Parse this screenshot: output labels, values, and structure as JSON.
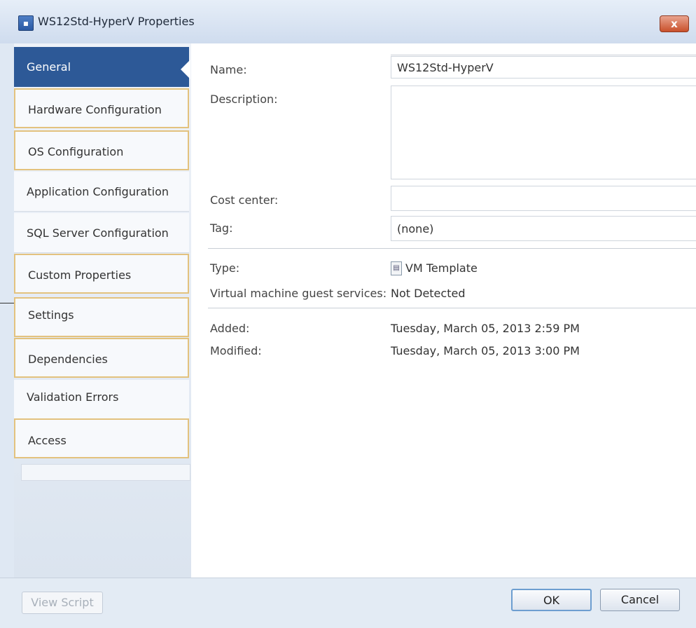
{
  "window": {
    "title": "WS12Std-HyperV Properties",
    "close_label": "x"
  },
  "sidebar": {
    "items": [
      {
        "label": "General"
      },
      {
        "label": "Hardware Configuration"
      },
      {
        "label": "OS Configuration"
      },
      {
        "label": "Application Configuration"
      },
      {
        "label": "SQL Server Configuration"
      },
      {
        "label": "Custom Properties"
      },
      {
        "label": "Settings"
      },
      {
        "label": "Dependencies"
      },
      {
        "label": "Validation Errors"
      },
      {
        "label": "Access"
      }
    ],
    "active_index": 0
  },
  "general": {
    "name_label": "Name:",
    "name_value": "WS12Std-HyperV",
    "description_label": "Description:",
    "description_value": "",
    "cost_center_label": "Cost center:",
    "cost_center_value": "",
    "tag_label": "Tag:",
    "tag_value": "(none)",
    "type_label": "Type:",
    "type_value": "VM Template",
    "guest_services_label": "Virtual machine guest services:",
    "guest_services_value": "Not Detected",
    "added_label": "Added:",
    "added_value": "Tuesday, March 05, 2013 2:59 PM",
    "modified_label": "Modified:",
    "modified_value": "Tuesday, March 05, 2013 3:00 PM"
  },
  "footer": {
    "view_script_label": "View Script",
    "ok_label": "OK",
    "cancel_label": "Cancel"
  },
  "colors": {
    "active_nav": "#2d5997",
    "highlight_border": "#e3c27e",
    "close_button": "#c9502b"
  }
}
